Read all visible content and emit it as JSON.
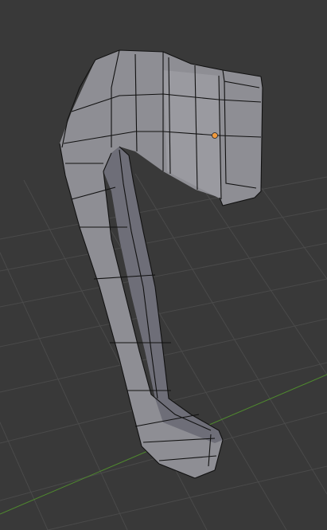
{
  "viewport": {
    "background_color": "#393939",
    "grid_color": "#4a4a4a",
    "x_axis_color": "#6e3a3a",
    "y_axis_color": "#4f8a2e",
    "mesh_fill_color": "#8e8e94",
    "mesh_shade_color": "#6e6e78",
    "mesh_inner_color": "#5f5f6b",
    "wire_color": "#111111",
    "origin_color": "#f09a3e"
  }
}
